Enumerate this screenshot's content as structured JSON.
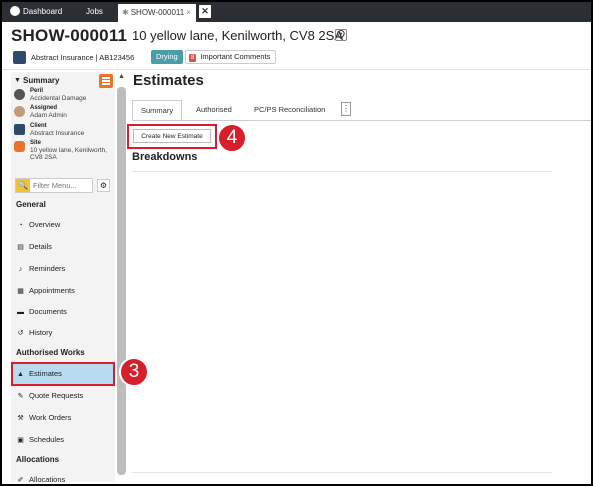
{
  "topnav": {
    "dashboard": "Dashboard",
    "jobs": "Jobs",
    "active_tab": "SHOW-000011",
    "tab_star": "✱",
    "tab_close": "×",
    "close_x": "✕"
  },
  "header": {
    "job_ref": "SHOW-000011",
    "address": "10 yellow lane, Kenilworth, CV8 2SA",
    "client_line": "Abstract Insurance | AB123456",
    "status_badge": "Drying",
    "comments_count": "8",
    "comments_label": "Important Comments"
  },
  "summary": {
    "title": "Summary",
    "items": [
      {
        "key": "Peril",
        "value": "Accidental Damage"
      },
      {
        "key": "Assigned",
        "value": "Adam Admin"
      },
      {
        "key": "Client",
        "value": "Abstract Insurance"
      },
      {
        "key": "Site",
        "value": "10 yellow lane, Kenilworth, CV8 2SA"
      }
    ]
  },
  "sidebar": {
    "filter_placeholder": "Filter Menu...",
    "sections": [
      {
        "title": "General",
        "items": [
          "Overview",
          "Details",
          "Reminders",
          "Appointments",
          "Documents",
          "History"
        ]
      },
      {
        "title": "Authorised Works",
        "items": [
          "Estimates",
          "Quote Requests",
          "Work Orders",
          "Schedules"
        ]
      },
      {
        "title": "Allocations",
        "items": [
          "Allocations"
        ]
      }
    ]
  },
  "main": {
    "title": "Estimates",
    "tabs": [
      "Summary",
      "Authorised",
      "PC/PS Reconciliation"
    ],
    "tab_more": "⋮",
    "create_button": "Create New Estimate",
    "section_title": "Breakdowns"
  },
  "callouts": {
    "step4": "4",
    "step3": "3"
  },
  "colors": {
    "nav_bg": "#2b2f35",
    "drying": "#4a9dab",
    "highlight": "#d61f2b",
    "active_row": "#b7dbef",
    "menu_btn": "#e8742c"
  }
}
